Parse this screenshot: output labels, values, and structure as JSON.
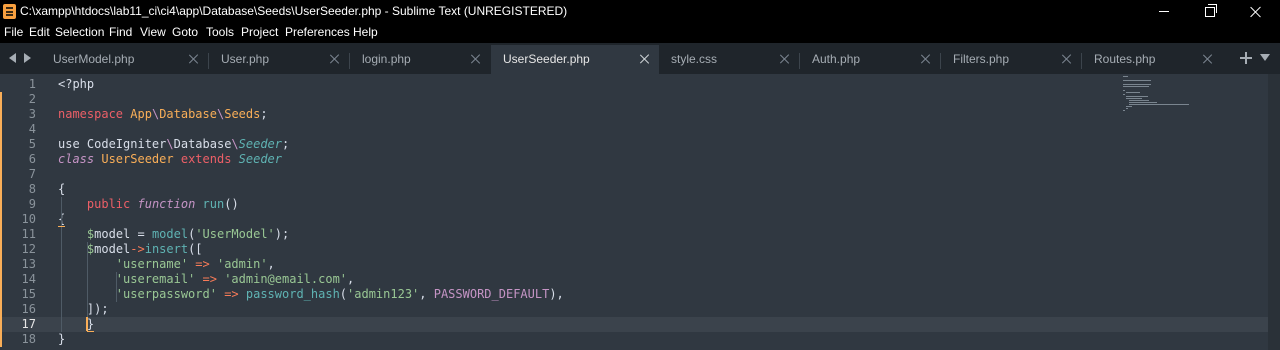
{
  "window": {
    "title": "C:\\xampp\\htdocs\\lab11_ci\\ci4\\app\\Database\\Seeds\\UserSeeder.php - Sublime Text (UNREGISTERED)"
  },
  "icons": {
    "app": "sublime-text-icon",
    "minimize": "minimize-icon",
    "maximize": "maximize-icon",
    "close": "close-icon",
    "nav_back": "chevron-left-icon",
    "nav_forward": "chevron-right-icon",
    "new_tab": "plus-icon",
    "tab_menu": "chevron-down-icon"
  },
  "menu": [
    "File",
    "Edit",
    "Selection",
    "Find",
    "View",
    "Goto",
    "Tools",
    "Project",
    "Preferences",
    "Help"
  ],
  "tabs": [
    {
      "label": "UserModel.php",
      "active": false
    },
    {
      "label": "User.php",
      "active": false
    },
    {
      "label": "login.php",
      "active": false
    },
    {
      "label": "UserSeeder.php",
      "active": true
    },
    {
      "label": "style.css",
      "active": false
    },
    {
      "label": "Auth.php",
      "active": false
    },
    {
      "label": "Filters.php",
      "active": false
    },
    {
      "label": "Routes.php",
      "active": false
    }
  ],
  "editor": {
    "current_line": 17,
    "line_numbers": [
      "1",
      "2",
      "3",
      "4",
      "5",
      "6",
      "7",
      "8",
      "9",
      "10",
      "11",
      "12",
      "13",
      "14",
      "15",
      "16",
      "17",
      "18"
    ],
    "lines": [
      [
        {
          "t": "<?php",
          "c": "plain"
        }
      ],
      [],
      [
        {
          "t": "namespace",
          "c": "kw"
        },
        {
          "t": " ",
          "c": "plain"
        },
        {
          "t": "App",
          "c": "ns"
        },
        {
          "t": "\\",
          "c": "sep"
        },
        {
          "t": "Database",
          "c": "ns"
        },
        {
          "t": "\\",
          "c": "sep"
        },
        {
          "t": "Seeds",
          "c": "ns"
        },
        {
          "t": ";",
          "c": "plain"
        }
      ],
      [],
      [
        {
          "t": "use",
          "c": "plain"
        },
        {
          "t": " CodeIgniter",
          "c": "plain"
        },
        {
          "t": "\\",
          "c": "sep"
        },
        {
          "t": "Database",
          "c": "plain"
        },
        {
          "t": "\\",
          "c": "sep"
        },
        {
          "t": "Seeder",
          "c": "italic"
        },
        {
          "t": ";",
          "c": "plain"
        }
      ],
      [
        {
          "t": "class",
          "c": "store"
        },
        {
          "t": " ",
          "c": "plain"
        },
        {
          "t": "UserSeeder",
          "c": "ns"
        },
        {
          "t": " ",
          "c": "plain"
        },
        {
          "t": "extends",
          "c": "kw"
        },
        {
          "t": " ",
          "c": "plain"
        },
        {
          "t": "Seeder",
          "c": "italic"
        }
      ],
      [],
      [
        {
          "t": "{",
          "c": "plain"
        }
      ],
      [
        {
          "t": "    ",
          "c": "plain"
        },
        {
          "t": "public",
          "c": "kw"
        },
        {
          "t": " ",
          "c": "plain"
        },
        {
          "t": "function",
          "c": "store"
        },
        {
          "t": " ",
          "c": "plain"
        },
        {
          "t": "run",
          "c": "func"
        },
        {
          "t": "()",
          "c": "plain"
        }
      ],
      [
        {
          "t": "{",
          "c": "plain"
        }
      ],
      [
        {
          "t": "    ",
          "c": "plain"
        },
        {
          "t": "$",
          "c": "var"
        },
        {
          "t": "model",
          "c": "plain"
        },
        {
          "t": " = ",
          "c": "plain"
        },
        {
          "t": "model",
          "c": "func"
        },
        {
          "t": "(",
          "c": "plain"
        },
        {
          "t": "'UserModel'",
          "c": "str"
        },
        {
          "t": ");",
          "c": "plain"
        }
      ],
      [
        {
          "t": "    ",
          "c": "plain"
        },
        {
          "t": "$",
          "c": "var"
        },
        {
          "t": "model",
          "c": "plain"
        },
        {
          "t": "->",
          "c": "op"
        },
        {
          "t": "insert",
          "c": "func"
        },
        {
          "t": "([",
          "c": "plain"
        }
      ],
      [
        {
          "t": "        ",
          "c": "plain"
        },
        {
          "t": "'username'",
          "c": "str"
        },
        {
          "t": " ",
          "c": "plain"
        },
        {
          "t": "=>",
          "c": "op"
        },
        {
          "t": " ",
          "c": "plain"
        },
        {
          "t": "'admin'",
          "c": "str"
        },
        {
          "t": ",",
          "c": "plain"
        }
      ],
      [
        {
          "t": "        ",
          "c": "plain"
        },
        {
          "t": "'useremail'",
          "c": "str"
        },
        {
          "t": " ",
          "c": "plain"
        },
        {
          "t": "=>",
          "c": "op"
        },
        {
          "t": " ",
          "c": "plain"
        },
        {
          "t": "'admin@email.com'",
          "c": "str"
        },
        {
          "t": ",",
          "c": "plain"
        }
      ],
      [
        {
          "t": "        ",
          "c": "plain"
        },
        {
          "t": "'userpassword'",
          "c": "str"
        },
        {
          "t": " ",
          "c": "plain"
        },
        {
          "t": "=>",
          "c": "op"
        },
        {
          "t": " ",
          "c": "plain"
        },
        {
          "t": "password_hash",
          "c": "func"
        },
        {
          "t": "(",
          "c": "plain"
        },
        {
          "t": "'admin123'",
          "c": "str"
        },
        {
          "t": ", ",
          "c": "plain"
        },
        {
          "t": "PASSWORD_DEFAULT",
          "c": "const"
        },
        {
          "t": "),",
          "c": "plain"
        }
      ],
      [
        {
          "t": "    ]);",
          "c": "plain"
        }
      ],
      [
        {
          "t": "    ",
          "c": "plain"
        },
        {
          "t": "}",
          "c": "plain"
        }
      ],
      [
        {
          "t": "}",
          "c": "plain"
        }
      ]
    ]
  }
}
